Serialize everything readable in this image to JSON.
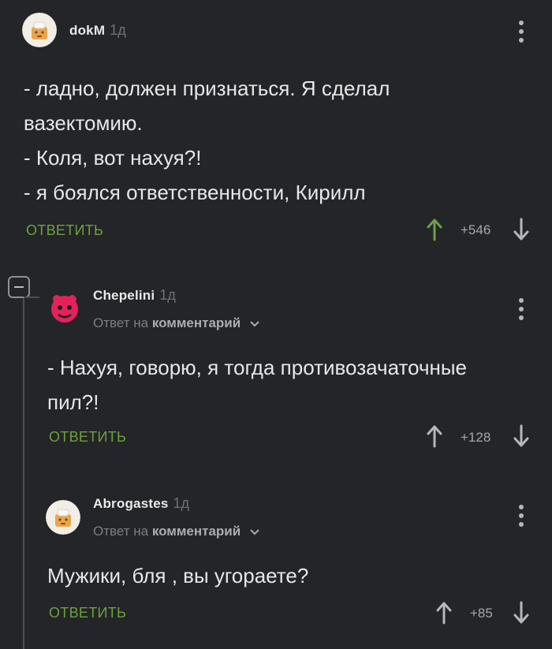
{
  "comments": [
    {
      "author": "dokM",
      "age": "1д",
      "lines": [
        "- ладно, должен признаться. Я сделал",
        "вазектомию.",
        "- Коля, вот нахуя?!",
        "- я боялся ответственности, Кирилл"
      ],
      "reply_label": "ОТВЕТИТЬ",
      "rating": "+546"
    },
    {
      "author": "Chepelini",
      "age": "1д",
      "reply_to_prefix": "Ответ на",
      "reply_to_target": "комментарий",
      "lines": [
        "- Нахуя, говорю, я тогда противозачаточные",
        "пил?!"
      ],
      "reply_label": "ОТВЕТИТЬ",
      "rating": "+128"
    },
    {
      "author": "Abrogastes",
      "age": "1д",
      "reply_to_prefix": "Ответ на",
      "reply_to_target": "комментарий",
      "lines": [
        "Мужики, бля , вы угораете?"
      ],
      "reply_label": "ОТВЕТИТЬ",
      "rating": "+85"
    }
  ],
  "colors": {
    "background": "#232528",
    "reply_green": "#6fa03f",
    "upvote_green": "#6fa03f",
    "thread_line": "#4a4d51"
  }
}
